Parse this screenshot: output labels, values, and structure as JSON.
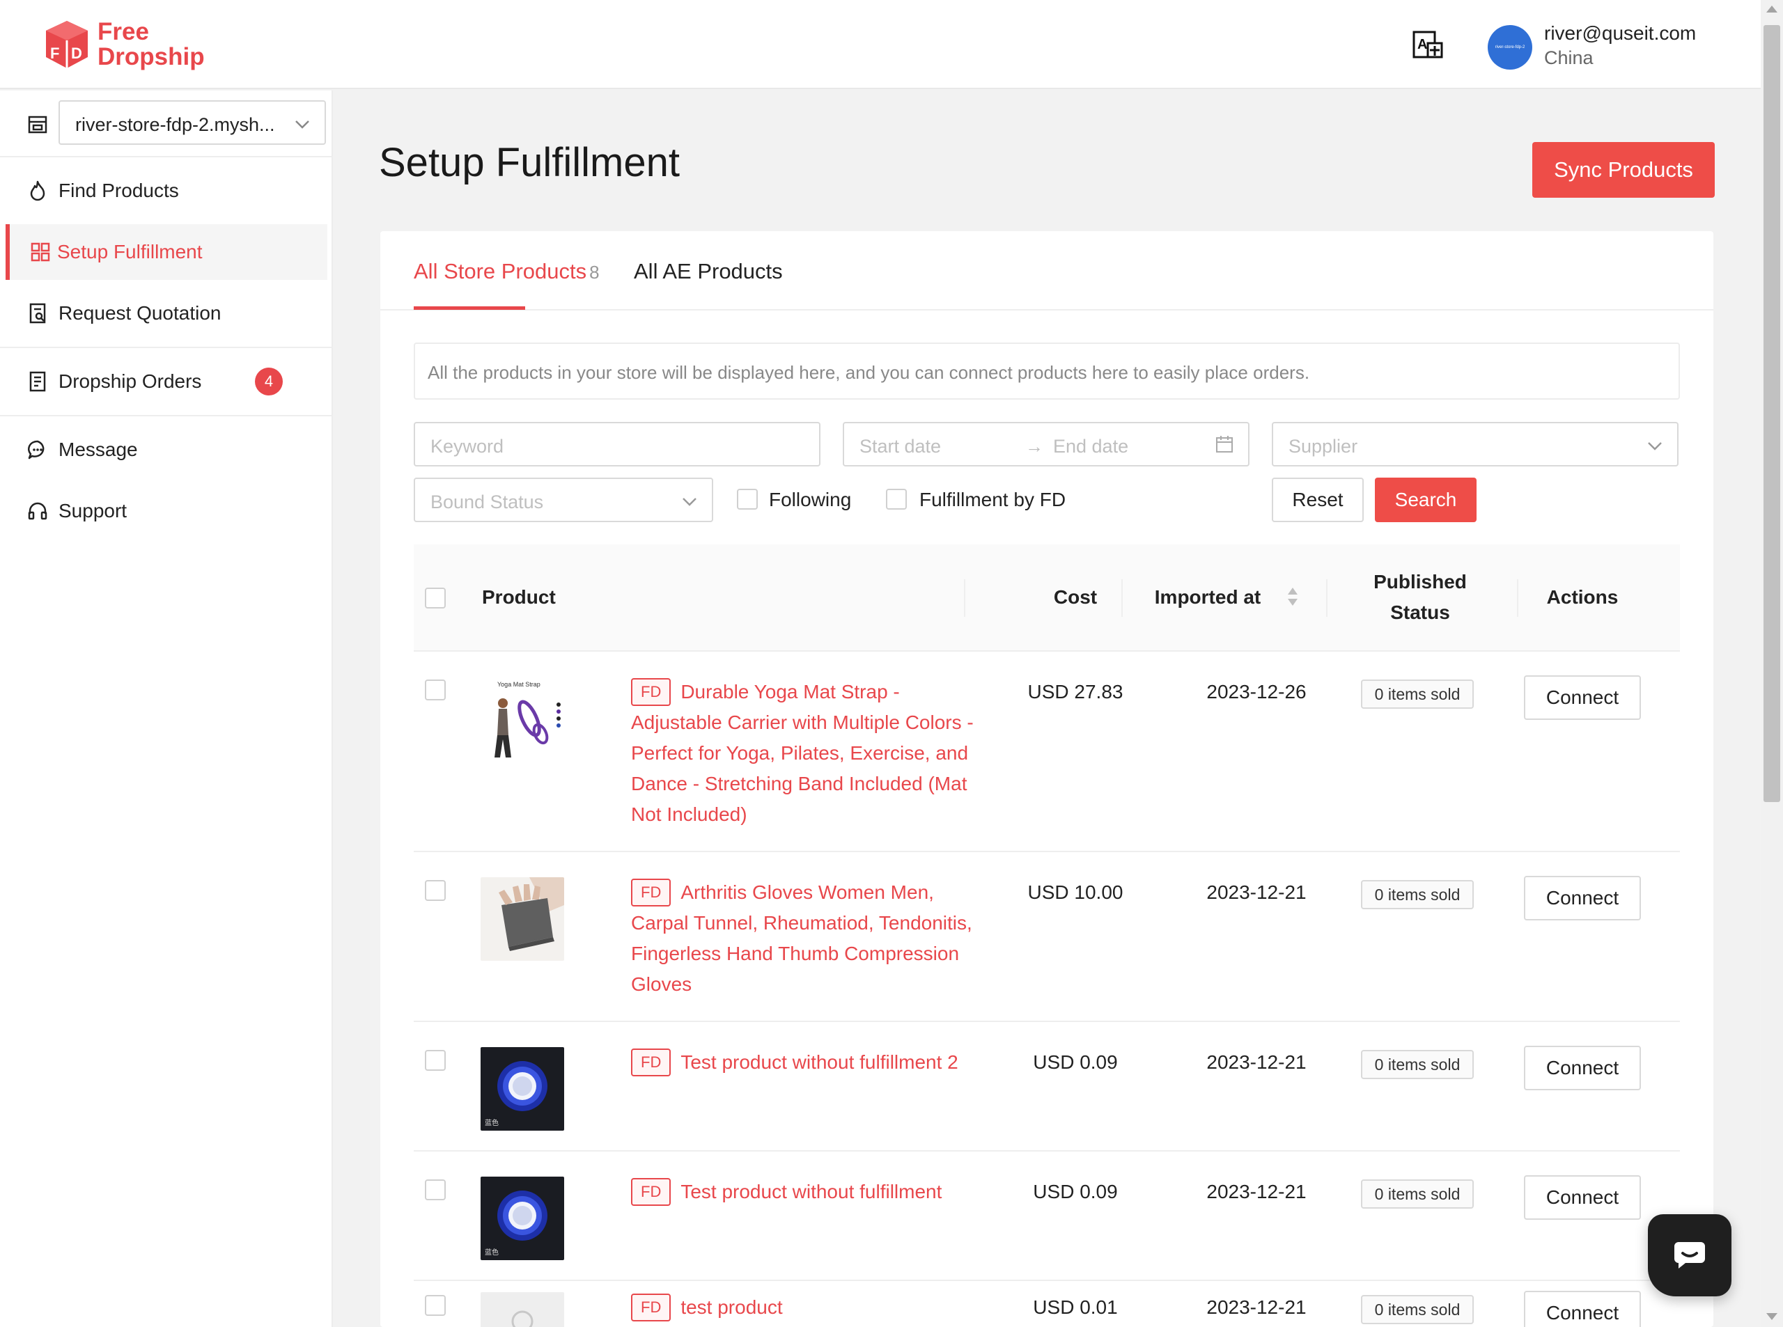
{
  "brand": {
    "line1": "Free",
    "line2": "Dropship",
    "color": "#e8474b"
  },
  "user": {
    "email": "river@quseit.com",
    "country": "China",
    "avatar_text": "river-store-fdp-2"
  },
  "sidebar": {
    "store": "river-store-fdp-2.mysh...",
    "items": [
      {
        "label": "Find Products",
        "icon": "fire-icon"
      },
      {
        "label": "Setup Fulfillment",
        "icon": "grid-icon"
      },
      {
        "label": "Request Quotation",
        "icon": "quote-doc-icon"
      },
      {
        "label": "Dropship Orders",
        "icon": "orders-doc-icon",
        "badge": "4"
      },
      {
        "label": "Message",
        "icon": "chat-bubble-icon"
      },
      {
        "label": "Support",
        "icon": "headset-icon"
      }
    ]
  },
  "page": {
    "title": "Setup Fulfillment",
    "sync_label": "Sync Products"
  },
  "tabs": [
    {
      "label": "All Store Products",
      "count": "8"
    },
    {
      "label": "All AE Products"
    }
  ],
  "info": "All the products in your store will be displayed here, and you can connect products here to easily place orders.",
  "filters": {
    "keyword_placeholder": "Keyword",
    "start_date_placeholder": "Start date",
    "end_date_placeholder": "End date",
    "supplier_placeholder": "Supplier",
    "bound_status_placeholder": "Bound Status",
    "following_label": "Following",
    "fulfillment_label": "Fulfillment by FD",
    "reset_label": "Reset",
    "search_label": "Search"
  },
  "table": {
    "headers": {
      "product": "Product",
      "cost": "Cost",
      "imported": "Imported at",
      "published_1": "Published",
      "published_2": "Status",
      "actions": "Actions"
    },
    "rows": [
      {
        "tag": "FD",
        "title": "Durable Yoga Mat Strap - Adjustable Carrier with Multiple Colors - Perfect for Yoga, Pilates, Exercise, and Dance - Stretching Band Included (Mat Not Included)",
        "cost": "USD 27.83",
        "imported": "2023-12-26",
        "sold": "0 items sold",
        "action": "Connect",
        "thumb_caption": "Yoga Mat Strap"
      },
      {
        "tag": "FD",
        "title": "Arthritis Gloves Women Men, Carpal Tunnel, Rheumatiod, Tendonitis, Fingerless Hand Thumb Compression Gloves",
        "cost": "USD 10.00",
        "imported": "2023-12-21",
        "sold": "0 items sold",
        "action": "Connect"
      },
      {
        "tag": "FD",
        "title": "Test product without fulfillment 2",
        "cost": "USD 0.09",
        "imported": "2023-12-21",
        "sold": "0 items sold",
        "action": "Connect",
        "thumb_caption": "蓝色"
      },
      {
        "tag": "FD",
        "title": "Test product without fulfillment",
        "cost": "USD 0.09",
        "imported": "2023-12-21",
        "sold": "0 items sold",
        "action": "Connect",
        "thumb_caption": "蓝色"
      },
      {
        "tag": "FD",
        "title": "test product",
        "cost": "USD 0.01",
        "imported": "2023-12-21",
        "sold": "0 items sold",
        "action": "Connect"
      }
    ]
  }
}
